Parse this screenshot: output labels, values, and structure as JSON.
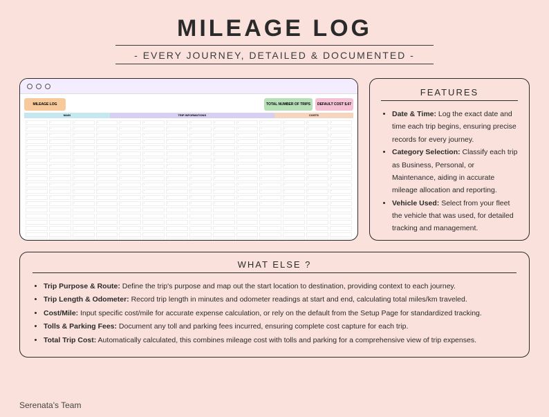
{
  "header": {
    "title": "MILEAGE LOG",
    "subtitle": "- EVERY JOURNEY, DETAILED & DOCUMENTED -"
  },
  "preview": {
    "logo": "MILEAGE LOG",
    "metric1": "TOTAL NUMBER OF TRIPS",
    "metric2": "DEFAULT COST",
    "metric2_val": "$.67",
    "section1": "MAIN",
    "section2": "TRIP INFORMATIONS",
    "section3": "COSTS"
  },
  "features": {
    "title": "FEATURES",
    "items": [
      {
        "label": "Date & Time:",
        "text": " Log the exact date and time each trip begins, ensuring precise records for every journey."
      },
      {
        "label": "Category Selection:",
        "text": " Classify each trip as Business, Personal, or Maintenance, aiding in accurate mileage allocation and reporting."
      },
      {
        "label": "Vehicle Used:",
        "text": " Select from your fleet the vehicle that was used, for detailed tracking and management."
      }
    ]
  },
  "whatelse": {
    "title": "WHAT ELSE ?",
    "items": [
      {
        "label": "Trip Purpose & Route:",
        "text": " Define the trip's purpose and map out the start location to destination, providing context to each journey."
      },
      {
        "label": "Trip Length & Odometer:",
        "text": " Record trip length in minutes and odometer readings at start and end, calculating total miles/km traveled."
      },
      {
        "label": "Cost/Mile:",
        "text": " Input specific cost/mile for accurate expense calculation, or rely on the default from the Setup Page for standardized tracking."
      },
      {
        "label": "Tolls & Parking Fees:",
        "text": " Document any toll and parking fees incurred, ensuring complete cost capture for each trip."
      },
      {
        "label": "Total Trip Cost:",
        "text": " Automatically calculated, this combines mileage cost with tolls and parking for a comprehensive view of trip expenses."
      }
    ]
  },
  "footer": "Serenata's Team"
}
